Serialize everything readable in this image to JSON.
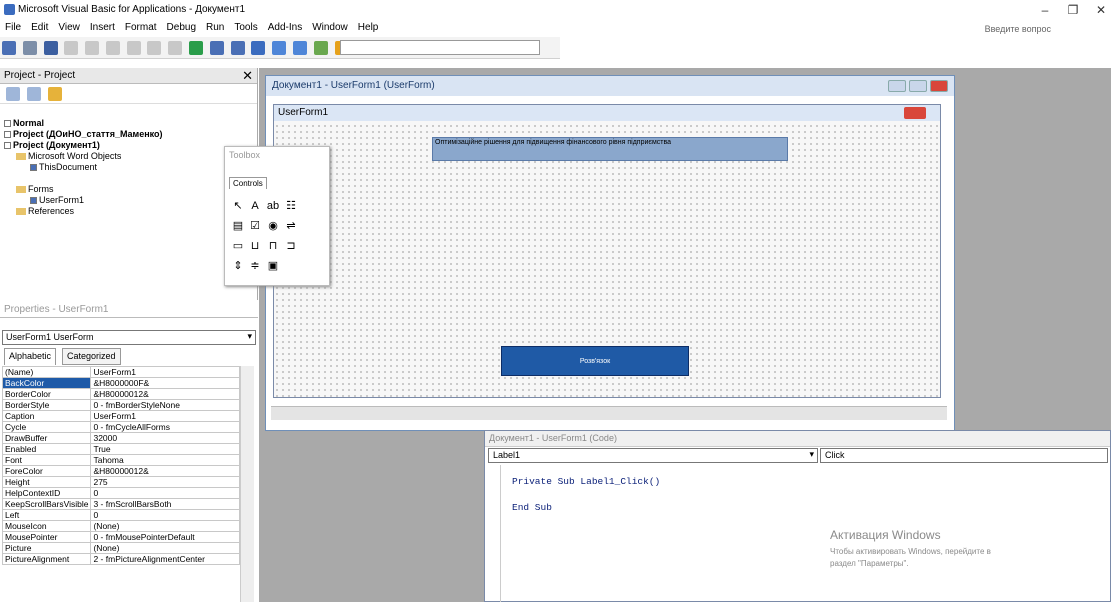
{
  "window": {
    "title": "Microsoft Visual Basic for Applications - Документ1",
    "help_search": "Введите вопрос"
  },
  "menu": [
    "File",
    "Edit",
    "View",
    "Insert",
    "Format",
    "Debug",
    "Run",
    "Tools",
    "Add-Ins",
    "Window",
    "Help"
  ],
  "project": {
    "title": "Project - Project",
    "items": [
      "Normal",
      "Project (ДОиНО_стаття_Маменко)",
      "Project (Документ1)",
      "Microsoft Word Objects",
      "ThisDocument",
      "Forms",
      "UserForm1",
      "References"
    ]
  },
  "properties": {
    "title": "Properties - UserForm1",
    "object": "UserForm1 UserForm",
    "tabs": [
      "Alphabetic",
      "Categorized"
    ],
    "rows": [
      [
        "(Name)",
        "UserForm1"
      ],
      [
        "BackColor",
        "&H8000000F&"
      ],
      [
        "BorderColor",
        "&H80000012&"
      ],
      [
        "BorderStyle",
        "0 - fmBorderStyleNone"
      ],
      [
        "Caption",
        "UserForm1"
      ],
      [
        "Cycle",
        "0 - fmCycleAllForms"
      ],
      [
        "DrawBuffer",
        "32000"
      ],
      [
        "Enabled",
        "True"
      ],
      [
        "Font",
        "Tahoma"
      ],
      [
        "ForeColor",
        "&H80000012&"
      ],
      [
        "Height",
        "275"
      ],
      [
        "HelpContextID",
        "0"
      ],
      [
        "KeepScrollBarsVisible",
        "3 - fmScrollBarsBoth"
      ],
      [
        "Left",
        "0"
      ],
      [
        "MouseIcon",
        "(None)"
      ],
      [
        "MousePointer",
        "0 - fmMousePointerDefault"
      ],
      [
        "Picture",
        "(None)"
      ],
      [
        "PictureAlignment",
        "2 - fmPictureAlignmentCenter"
      ]
    ]
  },
  "designer": {
    "title": "Документ1 - UserForm1 (UserForm)",
    "form_caption": "UserForm1",
    "label_text": "Оптимізаційне рішення для підвищення фінансового рівня підприємства",
    "button_text": "Розв'язок"
  },
  "toolbox": {
    "title": "Toolbox",
    "tab": "Controls"
  },
  "code": {
    "title": "Документ1 - UserForm1 (Code)",
    "object": "Label1",
    "procedure": "Click",
    "lines": [
      "Private Sub Label1_Click()",
      "End Sub"
    ]
  },
  "activation": {
    "line1": "Активация Windows",
    "line2": "Чтобы активировать Windows, перейдите в",
    "line3": "раздел \"Параметры\"."
  }
}
